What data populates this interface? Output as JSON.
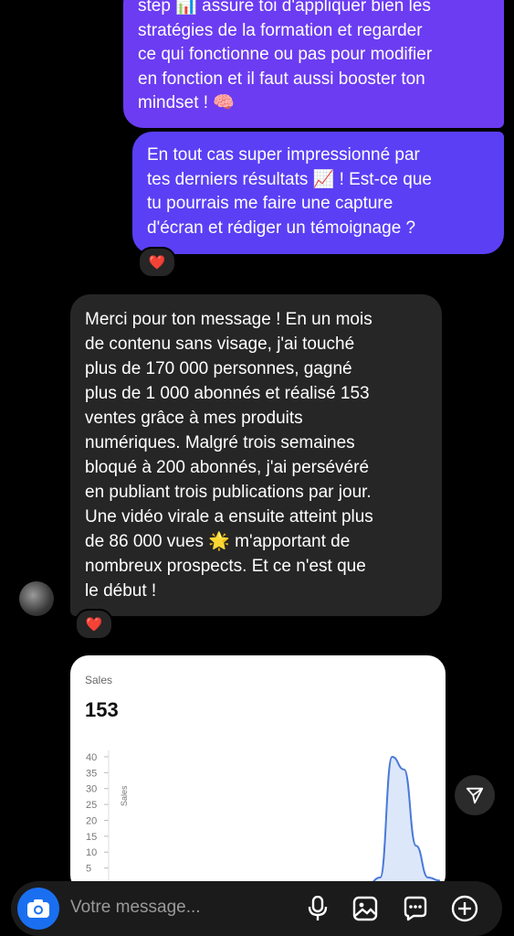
{
  "thread": {
    "outgoing_1": {
      "lines": [
        "step 📊 assure toi d'appliquer bien les",
        "stratégies de la formation et regarder",
        "ce qui fonctionne ou pas pour modifier",
        "en fonction et il faut aussi booster ton",
        "mindset ! 🧠"
      ]
    },
    "outgoing_2": {
      "lines": [
        "En tout cas super impressionné par",
        "tes derniers résultats 📈 ! Est-ce que",
        "tu pourrais me faire une capture",
        "d'écran et rédiger un témoignage ?"
      ],
      "reaction": "❤️"
    },
    "incoming": {
      "lines": [
        "Merci pour ton message ! En un mois",
        "de contenu sans visage, j'ai touché",
        "plus de 170 000 personnes, gagné",
        "plus de 1 000 abonnés et réalisé 153",
        "ventes grâce à mes produits",
        "numériques. Malgré trois semaines",
        "bloqué à 200 abonnés, j'ai persévéré",
        "en publiant trois publications par jour.",
        "Une vidéo virale a ensuite atteint plus",
        "de 86 000 vues 🌟 m'apportant de",
        "nombreux prospects. Et ce n'est que",
        "le début !"
      ],
      "reaction": "❤️"
    },
    "screenshot_card": {
      "label": "Sales",
      "total": "153",
      "chart_data": {
        "type": "area",
        "ylabel": "Sales",
        "y_ticks": [
          "40",
          "35",
          "30",
          "25",
          "20",
          "15",
          "10",
          "5"
        ],
        "ylim": [
          0,
          42
        ],
        "series": [
          {
            "values": [
              0,
              0,
              0,
              0,
              0,
              0,
              0,
              0,
              0,
              0,
              0,
              0,
              0,
              0,
              0,
              0,
              0,
              0,
              0,
              0,
              0,
              2,
              40,
              36,
              12,
              2,
              1
            ]
          }
        ],
        "colors": {
          "line": "#4a7ad8",
          "fill": "#dde7fa"
        }
      }
    }
  },
  "composer": {
    "placeholder": "Votre message...",
    "icons": [
      "camera-icon",
      "microphone-icon",
      "gallery-icon",
      "sticker-icon",
      "plus-icon"
    ]
  },
  "share_icon": "send-icon",
  "colors": {
    "outgoing": "#6c3cf2",
    "incoming": "#262626",
    "accent": "#1a6ff0"
  }
}
